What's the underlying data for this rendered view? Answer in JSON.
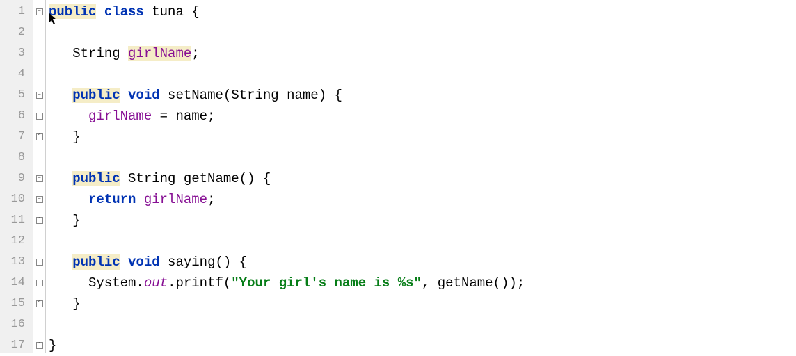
{
  "gutter": {
    "lines": [
      "1",
      "2",
      "3",
      "4",
      "5",
      "6",
      "7",
      "8",
      "9",
      "10",
      "11",
      "12",
      "13",
      "14",
      "15",
      "16",
      "17"
    ]
  },
  "fold": {
    "markers": [
      {
        "type": "open"
      },
      {
        "type": "line"
      },
      {
        "type": "line"
      },
      {
        "type": "line"
      },
      {
        "type": "open"
      },
      {
        "type": "open"
      },
      {
        "type": "close"
      },
      {
        "type": "line"
      },
      {
        "type": "open"
      },
      {
        "type": "open"
      },
      {
        "type": "close"
      },
      {
        "type": "line"
      },
      {
        "type": "open"
      },
      {
        "type": "open"
      },
      {
        "type": "close"
      },
      {
        "type": "line"
      },
      {
        "type": "close"
      }
    ]
  },
  "code": {
    "line1": {
      "public": "public",
      "class": "class",
      "tuna": " tuna {"
    },
    "line2": "",
    "line3": {
      "indent": "   ",
      "type": "String ",
      "field": "girlName",
      "semi": ";"
    },
    "line4": "",
    "line5": {
      "indent": "   ",
      "public": "public",
      "void": "void",
      "sig": " setName(String name) {"
    },
    "line6": {
      "indent": "     ",
      "field": "girlName",
      "rest": " = name;"
    },
    "line7": {
      "indent": "   ",
      "brace": "}"
    },
    "line8": "",
    "line9": {
      "indent": "   ",
      "public": "public",
      "rest": " String getName() {"
    },
    "line10": {
      "indent": "     ",
      "return": "return",
      "sp": " ",
      "field": "girlName",
      "semi": ";"
    },
    "line11": {
      "indent": "   ",
      "brace": "}"
    },
    "line12": "",
    "line13": {
      "indent": "   ",
      "public": "public",
      "void": "void",
      "sig": " saying() {"
    },
    "line14": {
      "indent": "     ",
      "sys": "System.",
      "out": "out",
      "printf": ".printf(",
      "str": "\"Your girl's name is %s\"",
      "rest": ", getName());"
    },
    "line15": {
      "indent": "   ",
      "brace": "}"
    },
    "line16": "",
    "line17": "}"
  }
}
